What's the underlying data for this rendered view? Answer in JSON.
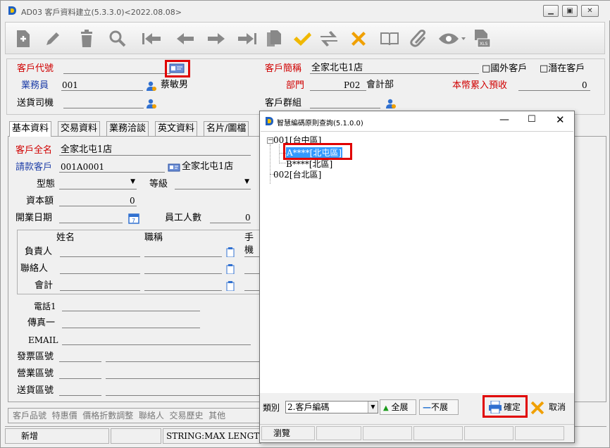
{
  "window": {
    "title": "AD03 客戶資料建立(5.3.3.0)<2022.08.08>"
  },
  "toolbar": {
    "icons": [
      "new-file",
      "edit",
      "delete",
      "search",
      "first",
      "prev",
      "next",
      "last",
      "copy",
      "confirm",
      "refresh",
      "cancel",
      "book",
      "attach",
      "view",
      "excel"
    ]
  },
  "header": {
    "customer_code_label": "客戶代號",
    "short_name_label": "客戶簡稱",
    "short_name_value": "全家北屯1店",
    "foreign_customer_label": "□國外客戶",
    "potential_customer_label": "□潛在客戶",
    "salesperson_label": "業務員",
    "salesperson_code": "001",
    "salesperson_name": "蔡敏男",
    "department_label": "部門",
    "department_code": "P02",
    "department_name": "會計部",
    "prepay_label": "本幣累入預收",
    "prepay_value": "0",
    "driver_label": "送貨司機",
    "group_label": "客戶群組"
  },
  "tabs": [
    "基本資料",
    "交易資料",
    "業務洽談",
    "英文資料",
    "名片/圖檔"
  ],
  "basic": {
    "fullname_label": "客戶全名",
    "fullname_value": "全家北屯1店",
    "billing_label": "請款客戶",
    "billing_code": "001A0001",
    "billing_name": "全家北屯1店",
    "type_label": "型態",
    "grade_label": "等級",
    "capital_label": "資本額",
    "capital_value": "0",
    "open_date_label": "開業日期",
    "employees_label": "員工人數",
    "employees_value": "0",
    "contact_col_name": "姓名",
    "contact_col_title": "職稱",
    "contact_col_mobile": "手機",
    "contact_rows": [
      "負責人",
      "聯絡人",
      "會計"
    ],
    "phone_label": "電話1",
    "fax_label": "傳真一",
    "email_label": "EMAIL",
    "invoice_area_label": "發票區號",
    "business_area_label": "營業區號",
    "delivery_area_label": "送貨區號"
  },
  "bottom_tabs": "客戶品號  特惠價  價格折數調整  聯絡人  交易歷史  其他",
  "status": {
    "mode": "新增",
    "info": "STRING:MAX LENGTH"
  },
  "dialog": {
    "title": "智慧編碼原則查詢(5.1.0.0)",
    "tree": [
      {
        "label": "001[台中區]",
        "level": 0,
        "expanded": true
      },
      {
        "label": "A****[北屯區]",
        "level": 1,
        "selected": true
      },
      {
        "label": "B****[北區]",
        "level": 1
      },
      {
        "label": "002[台北區]",
        "level": 0
      }
    ],
    "category_label": "類別",
    "category_value": "2.客戶編碼",
    "expand_all": "全展",
    "collapse_all": "不展",
    "ok_label": "確定",
    "cancel_label": "取消",
    "browse_label": "瀏覽"
  },
  "colors": {
    "red_label": "#d00000",
    "blue_label": "#1f3fa8",
    "highlight_box": "#e00000",
    "selection": "#3399ff"
  }
}
